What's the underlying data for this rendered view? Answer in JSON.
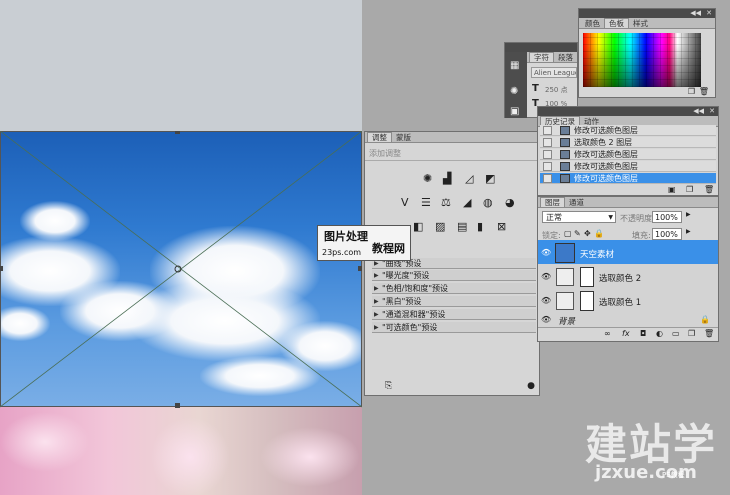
{
  "swatches_panel": {
    "tabs": [
      "颜色",
      "色板",
      "样式"
    ],
    "active_tab": 1
  },
  "character_panel": {
    "tabs": [
      "字符",
      "段落"
    ],
    "font_name": "Alien League",
    "font_size": "250 点",
    "leading": "100 %",
    "tracking": "100%"
  },
  "adjustments_panel": {
    "tabs": [
      "调整",
      "蒙版"
    ],
    "header": "添加调整",
    "presets": [
      "\"曲线\"预设",
      "\"曝光度\"预设",
      "\"色相/饱和度\"预设",
      "\"黑白\"预设",
      "\"通道混和器\"预设",
      "\"可选颜色\"预设"
    ]
  },
  "history_panel": {
    "tabs": [
      "历史记录",
      "动作"
    ],
    "rows": [
      "修改可选颜色图层",
      "选取颜色 2 图层",
      "修改可选颜色图层",
      "修改可选颜色图层",
      "修改可选颜色图层"
    ],
    "selected": 4
  },
  "layers_panel": {
    "tabs": [
      "图层",
      "通道"
    ],
    "blend_mode": "正常",
    "opacity_label": "不透明度:",
    "opacity": "100%",
    "lock_label": "锁定:",
    "fill_label": "填充:",
    "fill": "100%",
    "layers": [
      {
        "name": "天空素材",
        "selected": true
      },
      {
        "name": "选取颜色 2",
        "selected": false
      },
      {
        "name": "选取颜色 1",
        "selected": false
      },
      {
        "name": "背景",
        "selected": false
      }
    ]
  },
  "watermark": {
    "line1": "图片处理",
    "line2": "教程网",
    "url_small": "23ps.com",
    "big": "建站学",
    "url": "jzxue.com",
    "tag": "PS教程"
  }
}
